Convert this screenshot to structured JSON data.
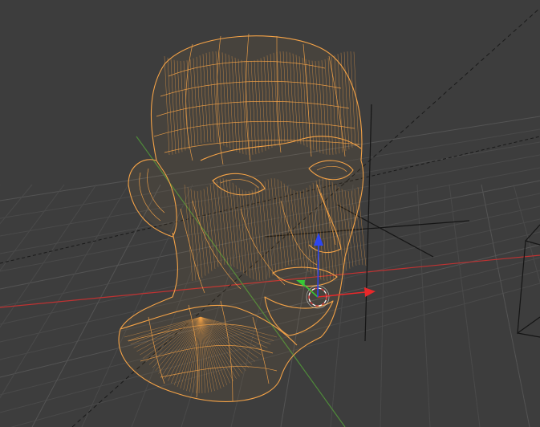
{
  "app": {
    "view": "3D Viewport"
  },
  "object": {
    "mode": "wireframe",
    "selected": true
  },
  "icons": {
    "gizmo": "translate-gizmo-icon",
    "camera": "camera-icon",
    "pivot": "pivot-point-icon"
  },
  "colors": {
    "background": "#3d3d3d",
    "wire_selected": "#f5a347",
    "axis_x": "#c03232",
    "axis_y": "#4f8a3a",
    "axis_z": "#2a4cd8",
    "gizmo_x": "#e8282a",
    "gizmo_y": "#36c936",
    "gizmo_z": "#2e46f0",
    "line_dark": "#151515"
  }
}
